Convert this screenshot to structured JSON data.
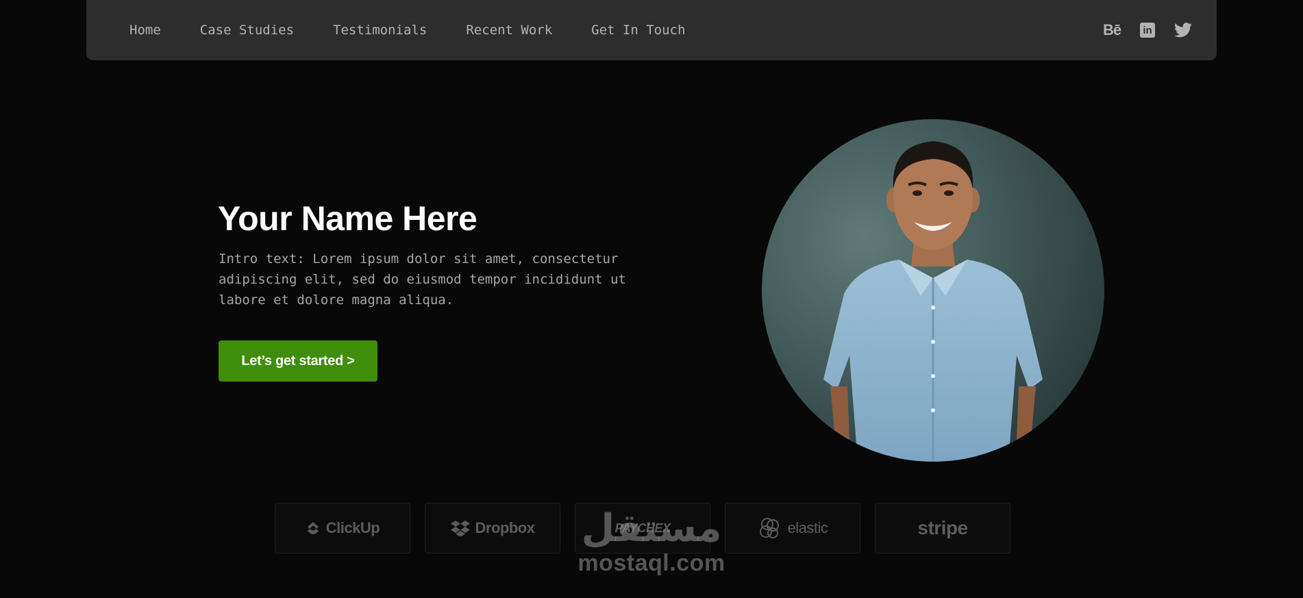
{
  "nav": {
    "links": [
      "Home",
      "Case Studies",
      "Testimonials",
      "Recent Work",
      "Get In Touch"
    ],
    "social": [
      {
        "icon": "behance-icon",
        "glyph": "Bē"
      },
      {
        "icon": "linkedin-icon",
        "glyph": "in"
      },
      {
        "icon": "twitter-icon"
      }
    ]
  },
  "hero": {
    "name": "Your Name Here",
    "intro": "Intro text: Lorem ipsum dolor sit amet, consectetur adipiscing elit, sed do eiusmod tempor incididunt ut labore et dolore magna aliqua.",
    "cta_label": "Let’s get started >"
  },
  "logos": [
    "ClickUp",
    "Dropbox",
    "PAYCHEX",
    "elastic",
    "stripe"
  ],
  "watermark": {
    "arabic": "مستقل",
    "latin": "mostaql.com"
  },
  "colors": {
    "accent": "#3e8e0b",
    "nav_bg": "#2d2d2d",
    "page_bg": "#080808"
  }
}
